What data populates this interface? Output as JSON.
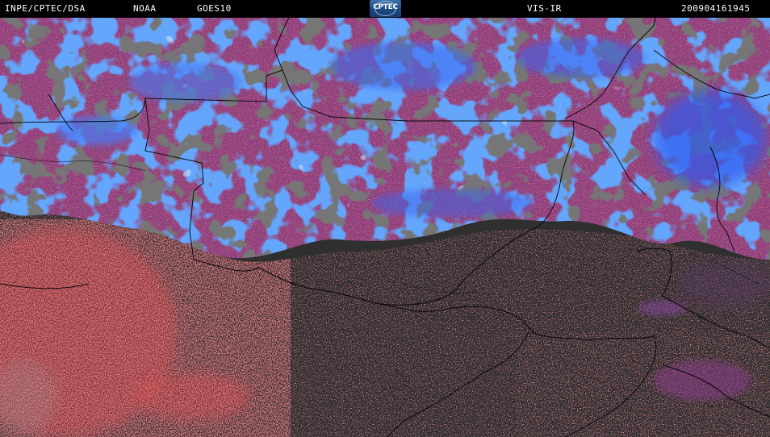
{
  "header": {
    "source": "INPE/CPTEC/DSA",
    "agency": "NOAA",
    "satellite": "GOES10",
    "logo_text": "CPTEC",
    "channel": "VIS-IR",
    "timestamp": "200904161945"
  },
  "colors": {
    "header_bg": "#000000",
    "header_text": "#ffffff",
    "cloud_cold": "#2a5cf0",
    "cloud_warm": "#b8487a",
    "surface_hot": "#d63a3a",
    "ground_dark": "#2f2f2f",
    "boundary_lines": "#000000"
  }
}
